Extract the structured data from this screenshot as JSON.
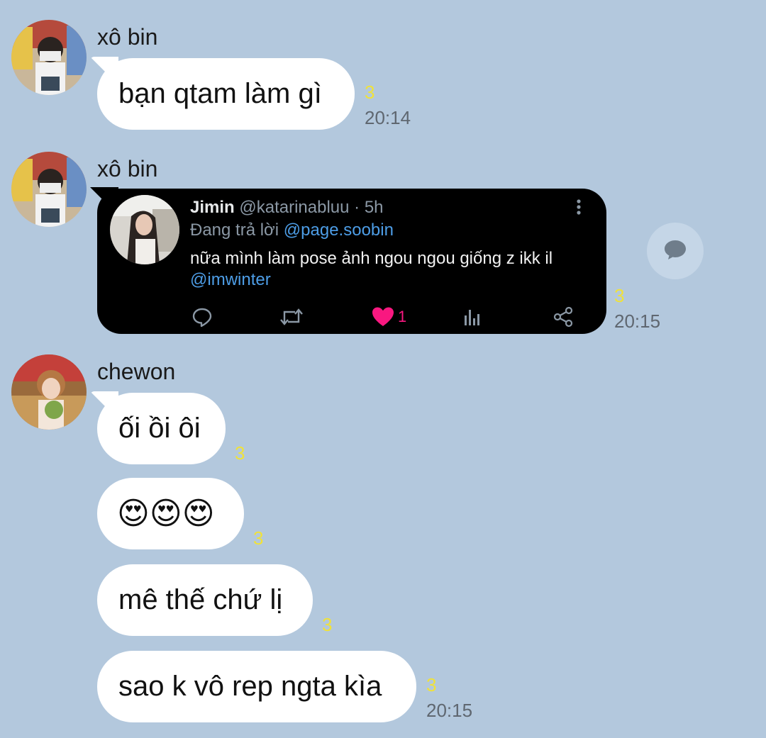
{
  "messages": [
    {
      "sender": "xô bin",
      "text": "bạn qtam làm gì",
      "read": "3",
      "time": "20:14"
    },
    {
      "sender": "xô bin",
      "read": "3",
      "time": "20:15",
      "tweet": {
        "name": "Jimin",
        "handle": "@katarinabluu",
        "age": "· 5h",
        "replying_prefix": "Đang trả lời",
        "replying_to": "@page.soobin",
        "body": "nữa mình làm pose ảnh ngou ngou giống z ikk il",
        "mention": "@imwinter",
        "like_count": "1"
      }
    },
    {
      "sender": "chewon",
      "text": "ối ồi ôi",
      "read": "3"
    },
    {
      "text": "😍😍😍",
      "read": "3"
    },
    {
      "text": "mê thế chứ lị",
      "read": "3"
    },
    {
      "text": "sao k vô rep ngta kìa",
      "read": "3",
      "time": "20:15"
    }
  ],
  "icons": {
    "tweet_more": "more-vertical-icon",
    "reply": "reply-icon",
    "retweet": "retweet-icon",
    "like": "heart-icon",
    "views": "views-icon",
    "share": "share-icon",
    "comment": "comment-bubble-icon"
  },
  "colors": {
    "background": "#b3c8dd",
    "bubble": "#ffffff",
    "read_marker": "#f0e23a",
    "like": "#f91880",
    "link": "#4d9de6"
  }
}
